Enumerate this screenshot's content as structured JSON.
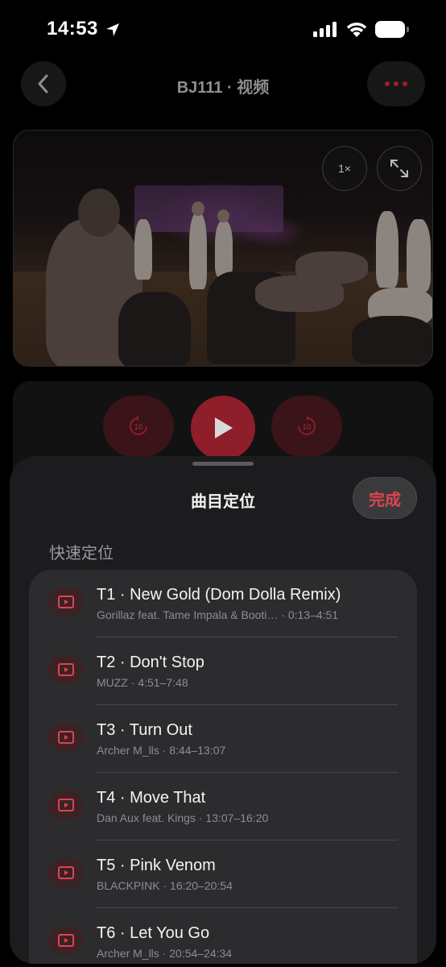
{
  "status_bar": {
    "time": "14:53"
  },
  "nav": {
    "title": "BJ111 · 视频"
  },
  "video": {
    "speed_label": "1×"
  },
  "sheet": {
    "title": "曲目定位",
    "done_label": "完成",
    "section_label": "快速定位",
    "tracks": [
      {
        "title": "T1 · New Gold (Dom Dolla Remix)",
        "subtitle": "Gorillaz feat. Tame Impala & Booti… · 0:13–4:51"
      },
      {
        "title": "T2 · Don't Stop",
        "subtitle": "MUZZ · 4:51–7:48"
      },
      {
        "title": "T3 · Turn Out",
        "subtitle": "Archer M_lls · 8:44–13:07"
      },
      {
        "title": "T4 · Move That",
        "subtitle": "Dan Aux feat. Kings · 13:07–16:20"
      },
      {
        "title": "T5 · Pink Venom",
        "subtitle": "BLACKPINK · 16:20–20:54"
      },
      {
        "title": "T6 · Let You Go",
        "subtitle": "Archer M_lls · 20:54–24:34"
      }
    ]
  },
  "colors": {
    "accent": "#e0434f",
    "background": "#000000",
    "sheet": "#1c1c1e"
  }
}
